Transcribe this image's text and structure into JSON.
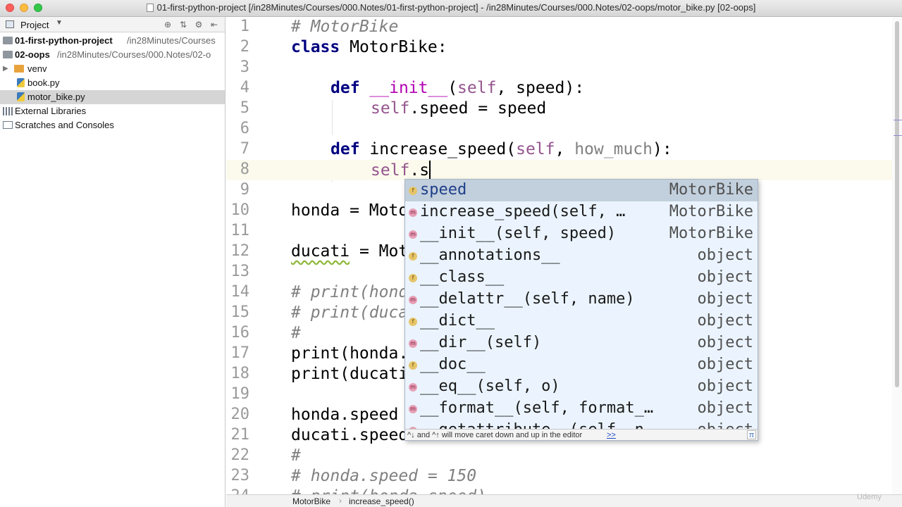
{
  "window": {
    "title": "01-first-python-project [/in28Minutes/Courses/000.Notes/01-first-python-project] - /in28Minutes/Courses/000.Notes/02-oops/motor_bike.py [02-oops]"
  },
  "project_panel": {
    "header_label": "Project",
    "tree": [
      {
        "name": "01-first-python-project",
        "path": "/in28Minutes/Courses",
        "icon": "folder-icon"
      },
      {
        "name": "02-oops",
        "path": "/in28Minutes/Courses/000.Notes/02-o",
        "icon": "folder-icon"
      },
      {
        "name": "venv",
        "icon": "folder-icon"
      },
      {
        "name": "book.py",
        "icon": "python-file-icon"
      },
      {
        "name": "motor_bike.py",
        "icon": "python-file-icon",
        "selected": true
      },
      {
        "name": "External Libraries",
        "icon": "library-icon"
      },
      {
        "name": "Scratches and Consoles",
        "icon": "scratch-icon"
      }
    ]
  },
  "editor": {
    "line_numbers": [
      "1",
      "2",
      "3",
      "4",
      "5",
      "6",
      "7",
      "8",
      "9",
      "10",
      "11",
      "12",
      "13",
      "14",
      "15",
      "16",
      "17",
      "18",
      "19",
      "20",
      "21",
      "22",
      "23",
      "24"
    ],
    "lines": {
      "l1": "# MotorBike",
      "l2_kw": "class",
      "l2_rest": " MotorBike:",
      "l4_kw": "def",
      "l4_fn": "__init__",
      "l4_open": "(",
      "l4_self": "self",
      "l4_rest": ", speed):",
      "l5_self": "self",
      "l5_rest": ".speed = speed",
      "l7_kw": "def",
      "l7_fn": " increase_speed(",
      "l7_self": "self",
      "l7_comma": ", ",
      "l7_param": "how_much",
      "l7_close": "):",
      "l8_self": "self",
      "l8_rest": ".s",
      "l10": "honda = Moto",
      "l12_var": "ducati",
      "l12_rest": " = Mot",
      "l14": "# print(hond",
      "l15": "# print(duca",
      "l16": "#",
      "l17": "print(honda.",
      "l18": "print(ducati",
      "l20": "honda.speed",
      "l21": "ducati.speed",
      "l22": "#",
      "l23": "# honda.speed = 150",
      "l24": "# print(honda.speed)"
    }
  },
  "completion_popup": {
    "items": [
      {
        "label": "speed",
        "type": "MotorBike",
        "badge": "f"
      },
      {
        "label": "increase_speed(self, …",
        "type": "MotorBike",
        "badge": "m"
      },
      {
        "label": "__init__(self, speed)",
        "type": "MotorBike",
        "badge": "m"
      },
      {
        "label": "__annotations__",
        "type": "object",
        "badge": "f"
      },
      {
        "label": "__class__",
        "type": "object",
        "badge": "f"
      },
      {
        "label": "__delattr__(self, name)",
        "type": "object",
        "badge": "m"
      },
      {
        "label": "__dict__",
        "type": "object",
        "badge": "f"
      },
      {
        "label": "__dir__(self)",
        "type": "object",
        "badge": "m"
      },
      {
        "label": "__doc__",
        "type": "object",
        "badge": "f"
      },
      {
        "label": "__eq__(self, o)",
        "type": "object",
        "badge": "m"
      },
      {
        "label": "__format__(self, format_…",
        "type": "object",
        "badge": "m"
      },
      {
        "label": "__getattribute__(self, n…",
        "type": "object",
        "badge": "m"
      }
    ],
    "footer_hint": "^↓ and ^↑ will move caret down and up in the editor",
    "footer_more": ">>",
    "footer_icon": "π"
  },
  "breadcrumb": {
    "items": [
      "MotorBike",
      "increase_speed()"
    ]
  },
  "watermark": "Udemy",
  "colors": {
    "keyword": "#000080",
    "self": "#94558d",
    "comment": "#808080",
    "popup_bg": "#ebf4fe",
    "popup_selected": "#c2cfdc"
  }
}
